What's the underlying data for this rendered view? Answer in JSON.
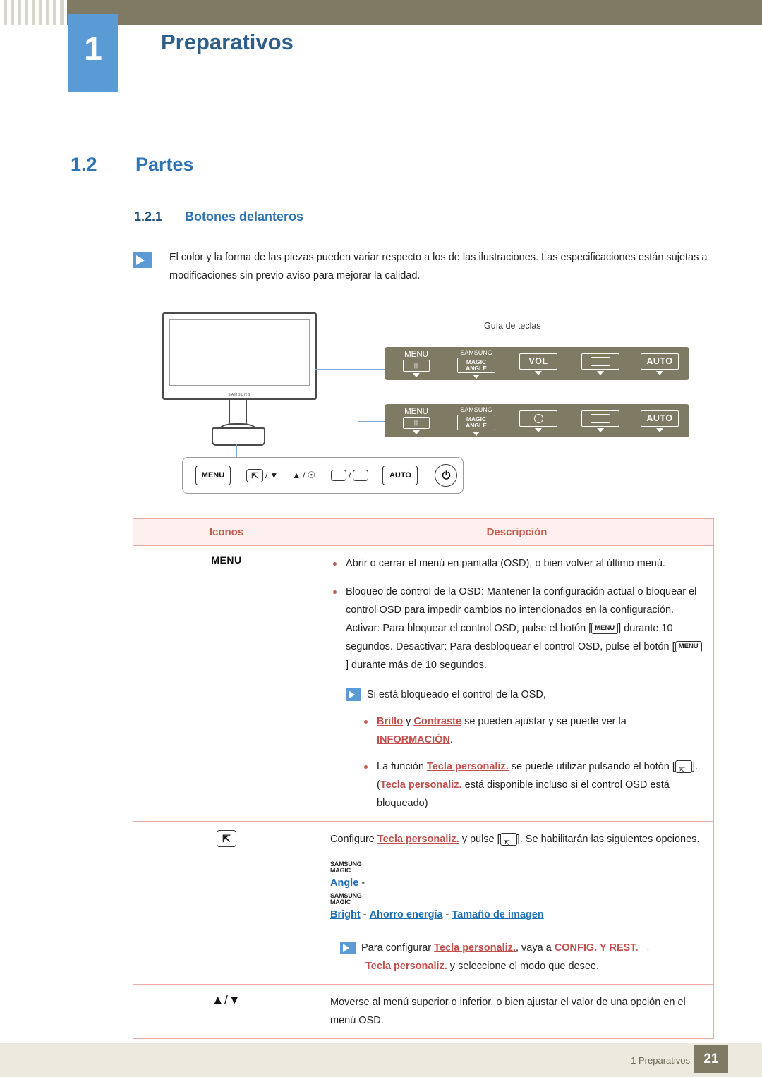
{
  "header": {
    "chapter_number": "1",
    "chapter_title": "Preparativos"
  },
  "section": {
    "number": "1.2",
    "title": "Partes",
    "sub_number": "1.2.1",
    "sub_title": "Botones delanteros"
  },
  "note": {
    "text": "El color y la forma de las piezas pueden variar respecto a los de las ilustraciones. Las especificaciones están sujetas a modificaciones sin previo aviso para mejorar la calidad."
  },
  "illustration": {
    "guide_label": "Guía de teclas",
    "monitor_logo": "SAMSUNG",
    "monitor_buttons": "......",
    "keybar1": [
      {
        "label": "MENU",
        "icon": "menu-box-icon"
      },
      {
        "label_top": "SAMSUNG",
        "label_mid": "MAGIC",
        "label_bot": "ANGLE",
        "icon": "magic-angle-icon"
      },
      {
        "label": "VOL",
        "icon": "vol-icon"
      },
      {
        "label": "",
        "icon": "source-icon"
      },
      {
        "label": "AUTO",
        "icon": "auto-icon"
      }
    ],
    "keybar2": [
      {
        "label": "MENU",
        "icon": "menu-box-icon"
      },
      {
        "label_top": "SAMSUNG",
        "label_mid": "MAGIC",
        "label_bot": "ANGLE",
        "icon": "magic-angle-icon"
      },
      {
        "label": "",
        "icon": "brightness-icon"
      },
      {
        "label": "",
        "icon": "source-icon"
      },
      {
        "label": "AUTO",
        "icon": "auto-icon"
      }
    ],
    "frontbar": [
      {
        "label": "MENU",
        "name": "menu-button"
      },
      {
        "label": "/",
        "name": "customkey-down-button"
      },
      {
        "label": "/",
        "name": "up-brightness-button"
      },
      {
        "label": "/",
        "name": "source-enter-button"
      },
      {
        "label": "AUTO",
        "name": "auto-button"
      },
      {
        "label": "",
        "name": "power-button"
      }
    ]
  },
  "table": {
    "headers": [
      "Iconos",
      "Descripción"
    ],
    "rows": [
      {
        "icon_label": "MENU",
        "icon_name": "menu-icon",
        "lines": [
          {
            "type": "bullet",
            "text": "Abrir o cerrar el menú en pantalla (OSD), o bien volver al último menú."
          },
          {
            "type": "bullet",
            "text": "Bloqueo de control de la OSD: Mantener la configuración actual o bloquear el control OSD para impedir cambios no intencionados en la configuración. Activar: Para bloquear el control OSD, pulse el botón [MENU] durante 10 segundos. Desactivar: Para desbloquear el control OSD, pulse el botón [MENU] durante más de 10 segundos."
          },
          {
            "type": "note",
            "text": "Si está bloqueado el control de la OSD,"
          },
          {
            "type": "subbullet-mixed",
            "text_a": "Brillo",
            "text_mid": " y ",
            "text_b": "Contraste",
            "text_c": " se pueden ajustar y se puede ver la ",
            "text_d": "INFORMACIÓN",
            "text_e": "."
          },
          {
            "type": "subbullet-mixed2",
            "pre": "La función ",
            "key1": "Tecla personaliz.",
            "mid": " se puede utilizar pulsando el botón [ ]. (",
            "key2": "Tecla personaliz.",
            "post": " está disponible incluso si el control OSD está bloqueado)"
          }
        ]
      },
      {
        "icon_label": "",
        "icon_name": "custom-key-icon",
        "lines": [
          {
            "type": "plain-mixed",
            "pre": "Configure ",
            "key": "Tecla personaliz.",
            "post": " y pulse [ ]. Se habilitarán las siguientes opciones."
          },
          {
            "type": "options",
            "items": [
              "Angle",
              "Bright",
              "Ahorro energía",
              "Tamaño de imagen"
            ],
            "magic_prefix": [
              "SAMSUNG",
              "MAGIC"
            ]
          },
          {
            "type": "note-mixed",
            "pre": "Para configurar ",
            "key": "Tecla personaliz.",
            "mid": ", vaya a ",
            "target": "CONFIG. Y REST.",
            "arrow": "→",
            "key2": "Tecla personaliz.",
            "post": " y seleccione el modo que desee."
          }
        ]
      },
      {
        "icon_label": "▲/▼",
        "icon_name": "up-down-icon",
        "lines": [
          {
            "type": "plain",
            "text": "Moverse al menú superior o inferior, o bien ajustar el valor de una opción en el menú OSD."
          }
        ]
      }
    ]
  },
  "footer": {
    "text": "1 Preparativos",
    "page": "21"
  }
}
